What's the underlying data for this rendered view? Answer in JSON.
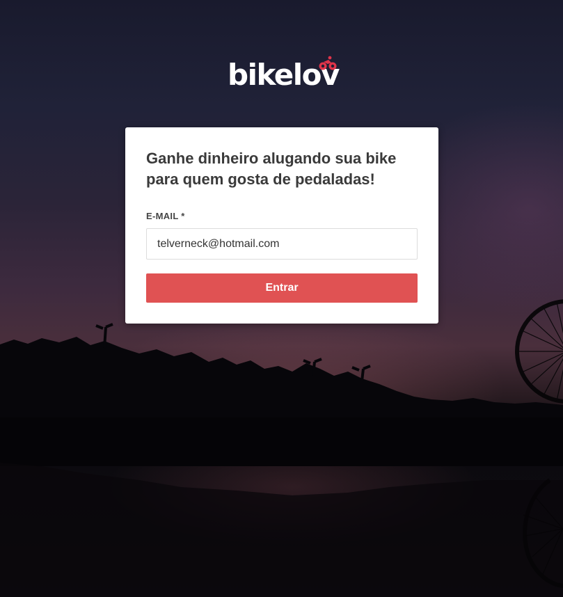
{
  "brand": {
    "name": "bikelov",
    "icon": "cyclist-icon",
    "accent_color": "#e0344a"
  },
  "login_card": {
    "headline": "Ganhe dinheiro alugando sua bike para quem gosta de pedaladas!",
    "email_label": "E-MAIL *",
    "email_value": "telverneck@hotmail.com",
    "submit_label": "Entrar",
    "submit_color": "#e05253"
  }
}
